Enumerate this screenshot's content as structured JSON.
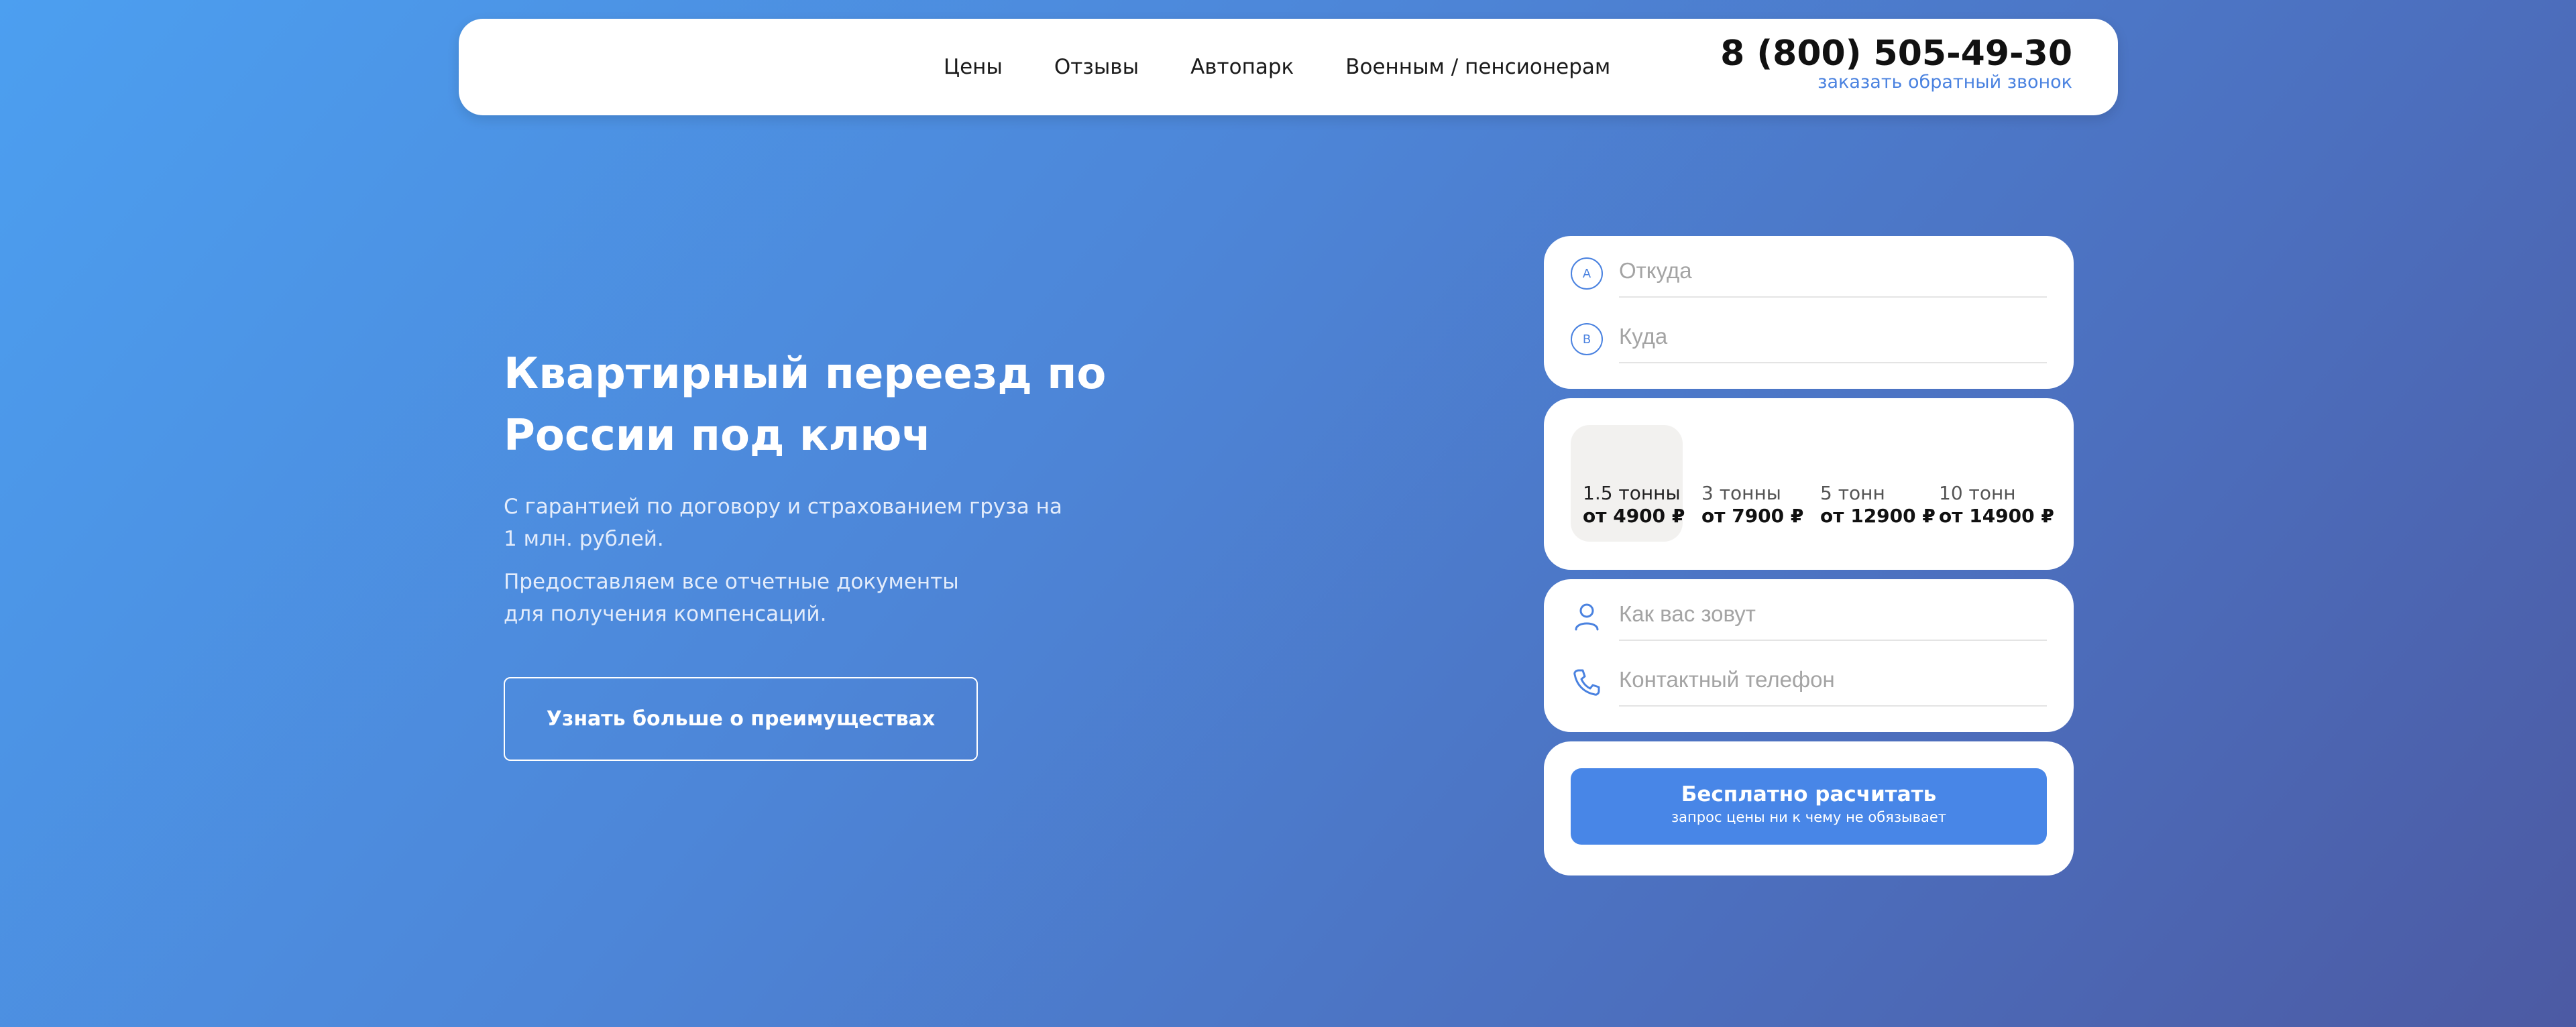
{
  "header": {
    "nav": [
      "Цены",
      "Отзывы",
      "Автопарк",
      "Военным / пенсионерам"
    ],
    "phone": "8 (800) 505-49-30",
    "callback": "заказать обратный звонок"
  },
  "hero": {
    "title": "Квартирный переезд по России под ключ",
    "text1_line1": "С гарантией по договору и страхованием груза на",
    "text1_line2": "1 млн. рублей.",
    "text2_line1": "Предоставляем все отчетные документы",
    "text2_line2": "для получения компенсаций.",
    "button": "Узнать больше о преимуществах"
  },
  "form": {
    "from": {
      "marker": "A",
      "placeholder": "Откуда"
    },
    "to": {
      "marker": "B",
      "placeholder": "Куда"
    },
    "trucks": [
      {
        "name": "1.5 тонны",
        "price": "от 4900 ₽",
        "selected": true
      },
      {
        "name": "3 тонны",
        "price": "от 7900 ₽",
        "selected": false
      },
      {
        "name": "5 тонн",
        "price": "от 12900 ₽",
        "selected": false
      },
      {
        "name": "10 тонн",
        "price": "от 14900 ₽",
        "selected": false
      }
    ],
    "name": {
      "icon": "user-icon",
      "placeholder": "Как вас зовут"
    },
    "phone": {
      "icon": "phone-icon",
      "placeholder": "Контактный телефон"
    },
    "submit": {
      "label": "Бесплатно расчитать",
      "sub": "запрос цены ни к чему не обязывает"
    }
  },
  "colors": {
    "accent": "#4886e7",
    "link": "#4a82e0",
    "selected_bg": "#f2f1ef"
  }
}
